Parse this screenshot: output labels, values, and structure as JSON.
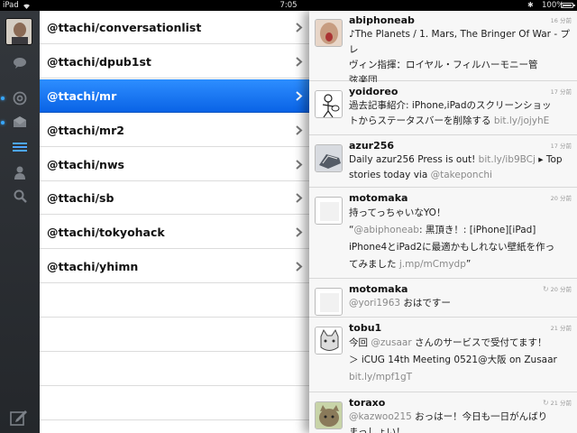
{
  "status_bar": {
    "device": "iPad",
    "time": "7:05",
    "battery": "100%",
    "bluetooth_icon": "bluetooth-icon",
    "wifi_icon": "wifi-icon"
  },
  "sidebar": {
    "icons": [
      "avatar",
      "speech-bubble-icon",
      "at-icon",
      "envelope-icon",
      "list-icon",
      "person-icon",
      "search-icon",
      "compose-icon"
    ],
    "accent_color": "#38a7ff"
  },
  "lists": [
    {
      "label": "@ttachi/conversationlist"
    },
    {
      "label": "@ttachi/dpub1st"
    },
    {
      "label": "@ttachi/mr"
    },
    {
      "label": "@ttachi/mr2"
    },
    {
      "label": "@ttachi/nws"
    },
    {
      "label": "@ttachi/sb"
    },
    {
      "label": "@ttachi/tokyohack"
    },
    {
      "label": "@ttachi/yhimn"
    }
  ],
  "selected_list_color": "#0a63e6",
  "tweets": [
    {
      "user": "abiphoneab",
      "time": "16 分前",
      "line1": "♪The Planets / 1. Mars, The Bringer Of War - プレ",
      "line2": "ヴィン指揮：ロイヤル・フィルハーモニー管",
      "line3": "弦楽団"
    },
    {
      "user": "yoidoreo",
      "time": "17 分前",
      "line1": "過去記事紹介: iPhone,iPadのスクリーンショッ",
      "line2": "トからステータスバーを削除する ",
      "link": "bit.ly/jojyhE"
    },
    {
      "user": "azur256",
      "time": "17 分前",
      "line1a": "Daily azur256 Press is out! ",
      "link1": "bit.ly/ib9BCj",
      "line1b": " ▸ Top",
      "line2a": "stories today via ",
      "link2": "@takeponchi"
    },
    {
      "user": "motomaka",
      "time": "20 分前",
      "line1": "持ってっちゃいなYO！",
      "line2_pre": "“",
      "link1": "@abiphoneab",
      "line2": ": 黒頂き！: [iPhone][iPad]",
      "line3": "iPhone4とiPad2に最適かもしれない壁紙を作っ",
      "line4": "てみました ",
      "link2": "j.mp/mCmydp",
      "line4_post": "”"
    },
    {
      "user": "motomaka",
      "time": "20 分前",
      "link": "@yori1963",
      "line1": " おはですー"
    },
    {
      "user": "tobu1",
      "time": "21 分前",
      "line1a": "今回 ",
      "link1": "@zusaar",
      "line1b": " さんのサービスで受付てます！",
      "line2": "＞ iCUG 14th Meeting 0521@大阪 on Zusaar",
      "link2": "bit.ly/mpf1gT"
    },
    {
      "user": "toraxo",
      "time": "21 分前",
      "link": "@kazwoo215",
      "line1": " おっはー！今日も一日がんばり",
      "line2": "まっしょい！"
    }
  ]
}
